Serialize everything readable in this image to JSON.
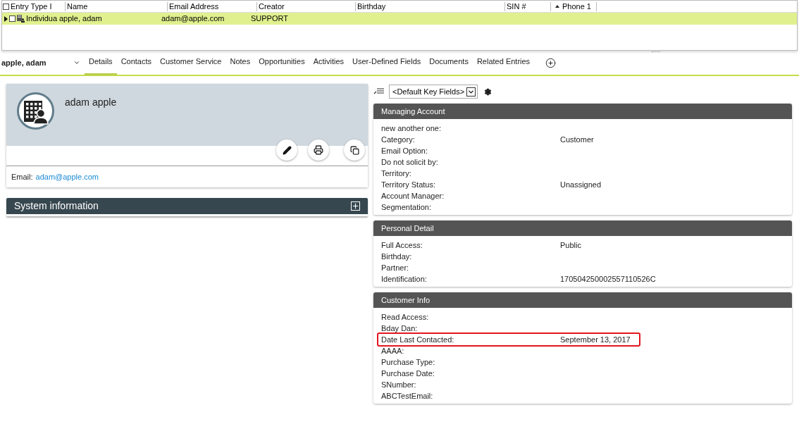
{
  "grid": {
    "select_all_checked": false,
    "columns": [
      {
        "label": "Entry Type I",
        "sorted": false
      },
      {
        "label": "Name",
        "sorted": false
      },
      {
        "label": "Email Address",
        "sorted": false
      },
      {
        "label": "Creator",
        "sorted": false
      },
      {
        "label": "Birthday",
        "sorted": false
      },
      {
        "label": "SIN #",
        "sorted": false
      },
      {
        "label": "Phone 1",
        "sorted": true
      }
    ],
    "rows": [
      {
        "selected": true,
        "checked": false,
        "cells": [
          "Individua",
          "apple, adam",
          "adam@apple.com",
          "SUPPORT",
          null,
          null,
          null
        ]
      }
    ]
  },
  "record_title": "apple, adam",
  "tabs": [
    {
      "label": "Details",
      "selected": true
    },
    {
      "label": "Contacts",
      "selected": false
    },
    {
      "label": "Customer Service",
      "selected": false
    },
    {
      "label": "Notes",
      "selected": false
    },
    {
      "label": "Opportunities",
      "selected": false
    },
    {
      "label": "Activities",
      "selected": false
    },
    {
      "label": "User-Defined Fields",
      "selected": false
    },
    {
      "label": "Documents",
      "selected": false
    },
    {
      "label": "Related Entries",
      "selected": false
    }
  ],
  "profile": {
    "name": "adam apple",
    "email_label": "Email:",
    "email": "adam@apple.com"
  },
  "system_info": {
    "title": "System information",
    "expanded": false
  },
  "key_fields": {
    "value": "<Default Key Fields>"
  },
  "panels": [
    {
      "title": "Managing Account",
      "fields": [
        {
          "label": "new another one:",
          "highlighted": false
        },
        {
          "label": "Category:",
          "value": "Customer",
          "highlighted": false
        },
        {
          "label": "Email Option:",
          "highlighted": false
        },
        {
          "label": "Do not solicit by:",
          "highlighted": false
        },
        {
          "label": "Territory:",
          "highlighted": false
        },
        {
          "label": "Territory Status:",
          "value": "Unassigned",
          "highlighted": false
        },
        {
          "label": "Account Manager:",
          "highlighted": false
        },
        {
          "label": "Segmentation:",
          "highlighted": false
        }
      ]
    },
    {
      "title": "Personal Detail",
      "fields": [
        {
          "label": "Full Access:",
          "value": "Public",
          "highlighted": false
        },
        {
          "label": "Birthday:",
          "highlighted": false
        },
        {
          "label": "Partner:",
          "highlighted": false
        },
        {
          "label": "Identification:",
          "value": "170504250002557110526C",
          "highlighted": false
        }
      ]
    },
    {
      "title": "Customer Info",
      "fields": [
        {
          "label": "Read Access:",
          "highlighted": false
        },
        {
          "label": "Bday Dan:",
          "highlighted": false
        },
        {
          "label": "Date Last Contacted:",
          "value": "September 13, 2017",
          "highlighted": true
        },
        {
          "label": "AAAA:",
          "highlighted": false
        },
        {
          "label": "Purchase Type:",
          "highlighted": false
        },
        {
          "label": "Purchase Date:",
          "highlighted": false
        },
        {
          "label": "SNumber:",
          "highlighted": false
        },
        {
          "label": "ABCTestEmail:",
          "highlighted": false
        }
      ]
    }
  ]
}
